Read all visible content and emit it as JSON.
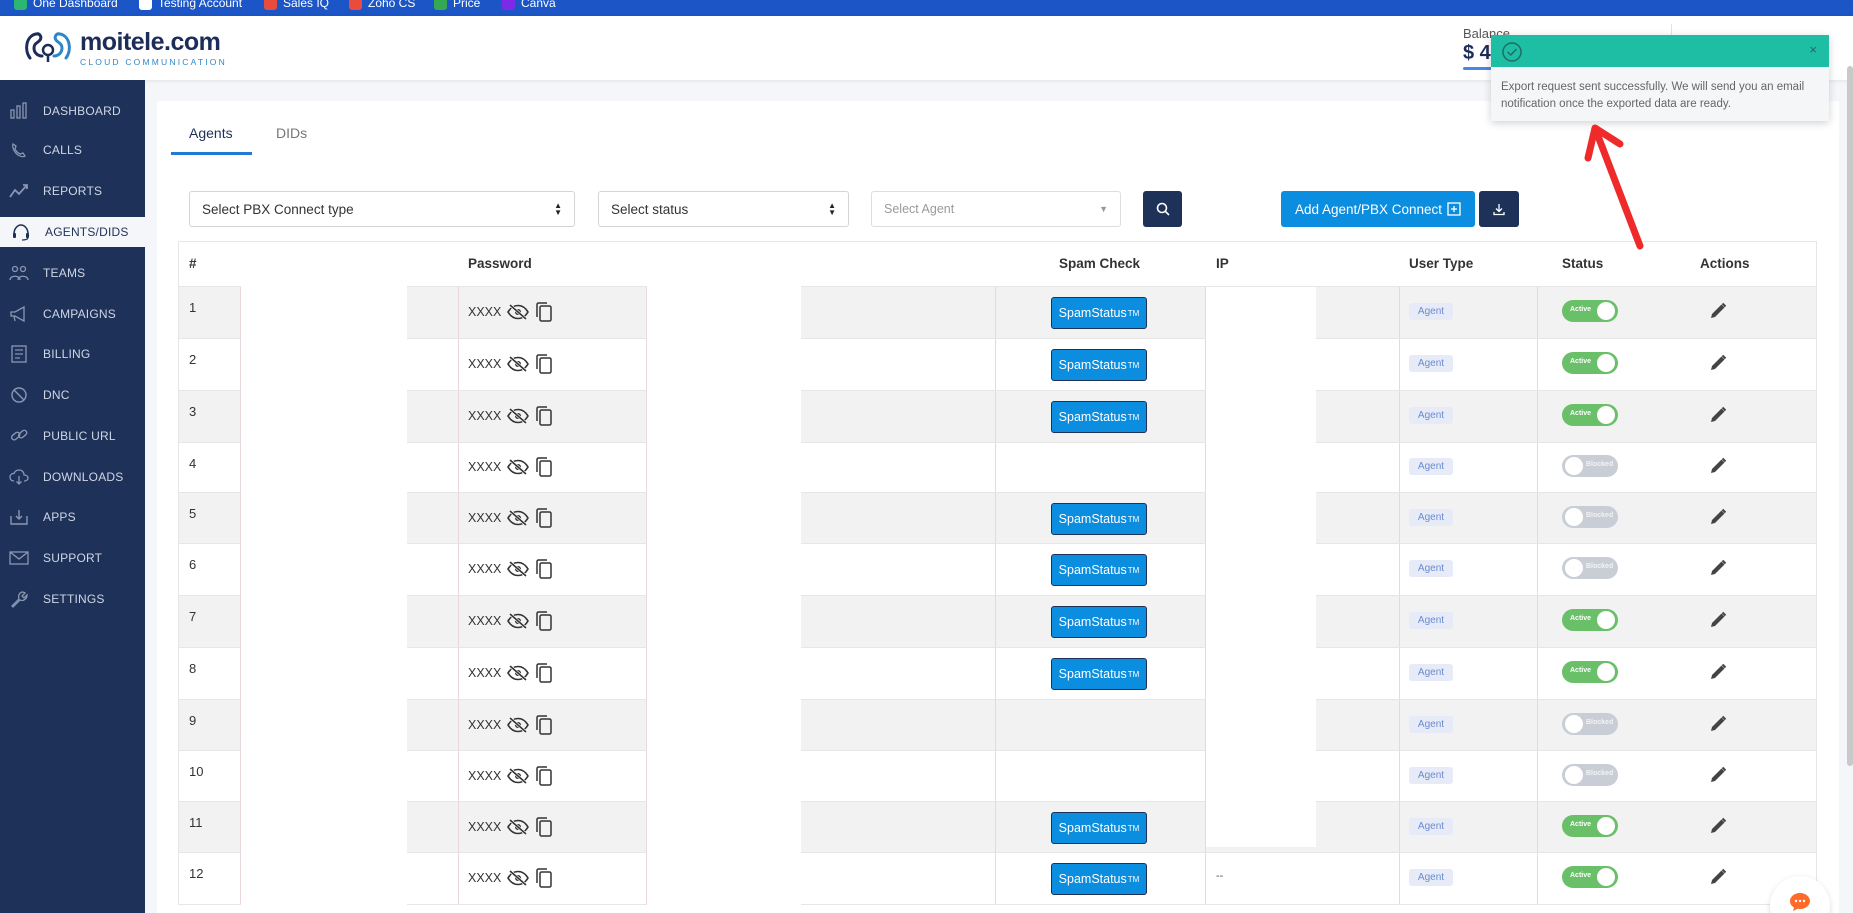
{
  "bookmarks": [
    {
      "label": "One Dashboard",
      "color": "#2bb673"
    },
    {
      "label": "Testing Account",
      "color": "#ffffff"
    },
    {
      "label": "Sales IQ",
      "color": "#e74c3c"
    },
    {
      "label": "Zoho CS",
      "color": "#e74c3c"
    },
    {
      "label": "Price",
      "color": "#34a853"
    },
    {
      "label": "Canva",
      "color": "#7d2ae8"
    }
  ],
  "brand": {
    "name": "moitele.com",
    "tagline": "CLOUD COMMUNICATION",
    "color": "#1c2d5a",
    "accent": "#2f86c6"
  },
  "header": {
    "balance_label": "Balance",
    "balance_value": "$ 4"
  },
  "sidebar": {
    "items": [
      {
        "label": "DASHBOARD",
        "icon": "dashboard-icon"
      },
      {
        "label": "CALLS",
        "icon": "phone-icon"
      },
      {
        "label": "REPORTS",
        "icon": "chart-line-icon"
      },
      {
        "label": "AGENTS/DIDS",
        "icon": "headset-icon",
        "active": true
      },
      {
        "label": "TEAMS",
        "icon": "team-icon"
      },
      {
        "label": "CAMPAIGNS",
        "icon": "megaphone-icon"
      },
      {
        "label": "BILLING",
        "icon": "billing-icon"
      },
      {
        "label": "DNC",
        "icon": "block-icon"
      },
      {
        "label": "PUBLIC URL",
        "icon": "link-icon"
      },
      {
        "label": "DOWNLOADS",
        "icon": "cloud-download-icon"
      },
      {
        "label": "APPS",
        "icon": "apps-download-icon"
      },
      {
        "label": "SUPPORT",
        "icon": "mail-icon"
      },
      {
        "label": "SETTINGS",
        "icon": "wrench-icon"
      }
    ]
  },
  "tabs": [
    {
      "label": "Agents",
      "active": true
    },
    {
      "label": "DIDs",
      "active": false
    }
  ],
  "filters": {
    "pbx_type": "Select PBX Connect type",
    "status": "Select status",
    "agent_placeholder": "Select Agent"
  },
  "actions": {
    "add_label": "Add Agent/PBX Connect"
  },
  "table": {
    "headers": {
      "num": "#",
      "password": "Password",
      "spam": "Spam Check",
      "ip": "IP",
      "user_type": "User Type",
      "status": "Status",
      "actions": "Actions"
    },
    "rows": [
      {
        "num": "1",
        "password": "XXXX",
        "spam": true,
        "user_type": "Agent",
        "status": "Active"
      },
      {
        "num": "2",
        "password": "XXXX",
        "spam": true,
        "user_type": "Agent",
        "status": "Active"
      },
      {
        "num": "3",
        "password": "XXXX",
        "spam": true,
        "user_type": "Agent",
        "status": "Active"
      },
      {
        "num": "4",
        "password": "XXXX",
        "spam": false,
        "user_type": "Agent",
        "status": "Blocked"
      },
      {
        "num": "5",
        "password": "XXXX",
        "spam": true,
        "user_type": "Agent",
        "status": "Blocked"
      },
      {
        "num": "6",
        "password": "XXXX",
        "spam": true,
        "user_type": "Agent",
        "status": "Blocked"
      },
      {
        "num": "7",
        "password": "XXXX",
        "spam": true,
        "user_type": "Agent",
        "status": "Active"
      },
      {
        "num": "8",
        "password": "XXXX",
        "spam": true,
        "user_type": "Agent",
        "status": "Active"
      },
      {
        "num": "9",
        "password": "XXXX",
        "spam": false,
        "user_type": "Agent",
        "status": "Blocked"
      },
      {
        "num": "10",
        "password": "XXXX",
        "spam": false,
        "user_type": "Agent",
        "status": "Blocked"
      },
      {
        "num": "11",
        "password": "XXXX",
        "spam": true,
        "user_type": "Agent",
        "status": "Active"
      },
      {
        "num": "12",
        "password": "XXXX",
        "spam": true,
        "user_type": "Agent",
        "status": "Active",
        "ip": "--"
      }
    ],
    "spam_label": "SpamStatus",
    "spam_sup": "TM"
  },
  "toast": {
    "message": "Export request sent successfully. We will send you an email notification once the exported data are ready.",
    "close": "×",
    "color": "#1ebea5"
  },
  "colors": {
    "primary": "#0b8de0",
    "navy": "#1e3158",
    "active": "#6abf69",
    "blocked": "#c9cdd6"
  }
}
